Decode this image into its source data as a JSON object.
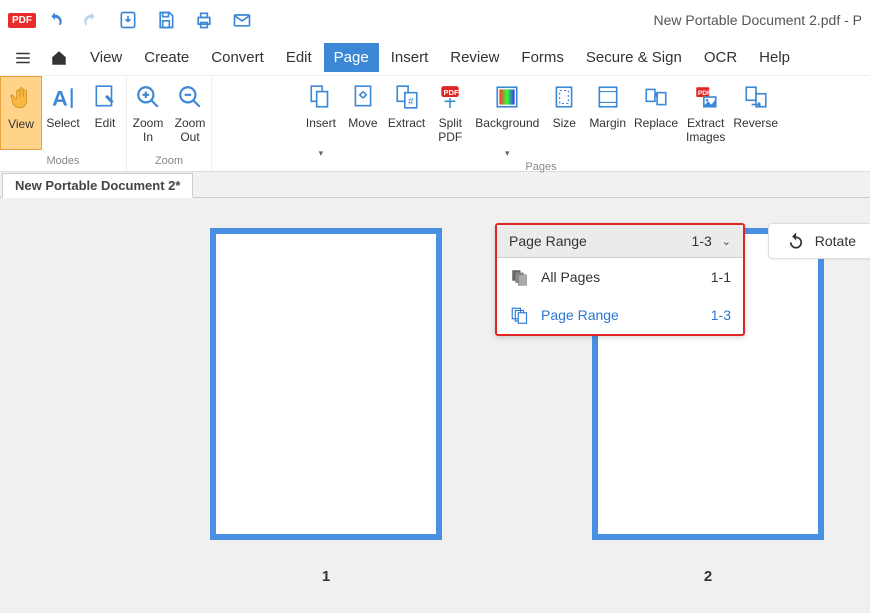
{
  "titlebar": {
    "app_badge": "PDF",
    "doc_title": "New Portable Document 2.pdf  -  P"
  },
  "menus": [
    "View",
    "Create",
    "Convert",
    "Edit",
    "Page",
    "Insert",
    "Review",
    "Forms",
    "Secure & Sign",
    "OCR",
    "Help"
  ],
  "active_menu": "Page",
  "ribbon": {
    "modes_label": "Modes",
    "zoom_label": "Zoom",
    "pages_label": "Pages",
    "view": "View",
    "select": "Select",
    "edit": "Edit",
    "zoom_in": "Zoom\nIn",
    "zoom_out": "Zoom\nOut",
    "insert": "Insert",
    "move": "Move",
    "extract": "Extract",
    "split": "Split\nPDF",
    "background": "Background",
    "size": "Size",
    "margin": "Margin",
    "replace": "Replace",
    "extract_images": "Extract\nImages",
    "reverse": "Reverse"
  },
  "doc_tab": "New Portable Document 2*",
  "page_numbers": [
    "1",
    "2"
  ],
  "range_panel": {
    "header_label": "Page Range",
    "header_value": "1-3",
    "all_pages_label": "All Pages",
    "all_pages_value": "1-1",
    "range_label": "Page Range",
    "range_value": "1-3"
  },
  "rotate_label": "Rotate"
}
